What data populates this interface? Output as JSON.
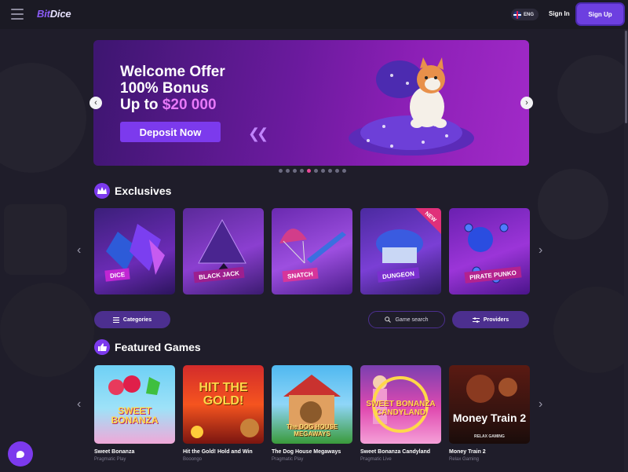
{
  "header": {
    "logo_part1": "Bit",
    "logo_part2": "Dice",
    "language": "ENG",
    "signin_label": "Sign In",
    "signup_label": "Sign Up"
  },
  "banner": {
    "line1": "Welcome Offer",
    "line2": "100% Bonus",
    "line3_prefix": "Up to",
    "line3_amount": "$20 000",
    "deposit_label": "Deposit Now",
    "slide_count": 10,
    "active_slide": 4
  },
  "exclusives": {
    "title": "Exclusives",
    "tiles": [
      {
        "label": "DICE"
      },
      {
        "label": "BLACK JACK"
      },
      {
        "label": "SNATCH"
      },
      {
        "label": "DUNGEON",
        "badge": "NEW"
      },
      {
        "label": "PIRATE PUNKO"
      }
    ]
  },
  "filters": {
    "categories_label": "Categories",
    "search_placeholder": "Game search",
    "providers_label": "Providers"
  },
  "featured": {
    "title": "Featured Games",
    "games": [
      {
        "name": "Sweet Bonanza",
        "provider": "Pragmatic Play",
        "art": "SWEET BONANZA"
      },
      {
        "name": "Hit the Gold! Hold and Win",
        "provider": "Booongo",
        "art": "HIT THE GOLD!"
      },
      {
        "name": "The Dog House Megaways",
        "provider": "Pragmatic Play",
        "art": "The DOG HOUSE MEGAWAYS"
      },
      {
        "name": "Sweet Bonanza Candyland",
        "provider": "Pragmatic Live",
        "art": "SWEET BONANZA CANDYLAND"
      },
      {
        "name": "Money Train 2",
        "provider": "Relax Gaming",
        "art": "Money Train 2",
        "art_sub": "RELAX GAMING"
      }
    ]
  },
  "colors": {
    "background": "#1f1d2a",
    "accent": "#7c3aed",
    "pill": "#4c2f8f",
    "pink": "#e879f9"
  }
}
